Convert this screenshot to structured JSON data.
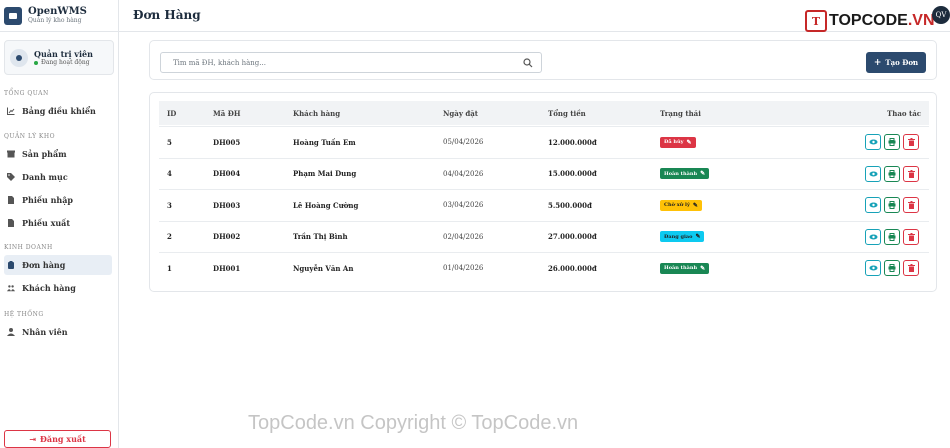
{
  "brand": {
    "title": "OpenWMS",
    "subtitle": "Quản lý kho hàng"
  },
  "user": {
    "name": "Quản trị viên",
    "status": "Đang hoạt động"
  },
  "sidebar": {
    "sections": [
      {
        "label": "TỔNG QUAN",
        "items": [
          {
            "label": "Bảng điều khiển",
            "icon": "chart-icon"
          }
        ]
      },
      {
        "label": "QUẢN LÝ KHO",
        "items": [
          {
            "label": "Sản phẩm",
            "icon": "box-icon"
          },
          {
            "label": "Danh mục",
            "icon": "tag-icon"
          },
          {
            "label": "Phiếu nhập",
            "icon": "file-icon"
          },
          {
            "label": "Phiếu xuất",
            "icon": "file-icon"
          }
        ]
      },
      {
        "label": "KINH DOANH",
        "items": [
          {
            "label": "Đơn hàng",
            "icon": "clipboard-icon",
            "active": true
          },
          {
            "label": "Khách hàng",
            "icon": "users-icon"
          }
        ]
      },
      {
        "label": "HỆ THỐNG",
        "items": [
          {
            "label": "Nhân viên",
            "icon": "user-tie-icon"
          }
        ]
      }
    ],
    "logout_label": "Đăng xuất"
  },
  "header": {
    "title": "Đơn Hàng",
    "avatar_initials": "QV",
    "logo_left": "TOPCODE",
    "logo_right": ".VN",
    "logo_mark": "T"
  },
  "toolbar": {
    "search_placeholder": "Tìm mã ĐH, khách hàng...",
    "new_button": "Tạo Đơn"
  },
  "table": {
    "headers": {
      "id": "ID",
      "code": "Mã ĐH",
      "customer": "Khách hàng",
      "date": "Ngày đặt",
      "total": "Tổng tiền",
      "status": "Trạng thái",
      "actions": "Thao tác"
    },
    "rows": [
      {
        "id": "5",
        "code": "DH005",
        "customer": "Hoàng Tuấn Em",
        "date": "05/04/2026",
        "total": "12.000.000đ",
        "status": "Đã hủy",
        "status_color": "#dc3545",
        "status_text_color": "#ffffff"
      },
      {
        "id": "4",
        "code": "DH004",
        "customer": "Phạm Mai Dung",
        "date": "04/04/2026",
        "total": "15.000.000đ",
        "status": "Hoàn thành",
        "status_color": "#198754",
        "status_text_color": "#ffffff"
      },
      {
        "id": "3",
        "code": "DH003",
        "customer": "Lê Hoàng Cường",
        "date": "03/04/2026",
        "total": "5.500.000đ",
        "status": "Chờ xử lý",
        "status_color": "#ffc107",
        "status_text_color": "#222222"
      },
      {
        "id": "2",
        "code": "DH002",
        "customer": "Trần Thị Bình",
        "date": "02/04/2026",
        "total": "27.000.000đ",
        "status": "Đang giao",
        "status_color": "#0dcaf0",
        "status_text_color": "#222222"
      },
      {
        "id": "1",
        "code": "DH001",
        "customer": "Nguyễn Văn An",
        "date": "01/04/2026",
        "total": "26.000.000đ",
        "status": "Hoàn thành",
        "status_color": "#198754",
        "status_text_color": "#ffffff"
      }
    ]
  },
  "watermark": "TopCode.vn   Copyright © TopCode.vn"
}
